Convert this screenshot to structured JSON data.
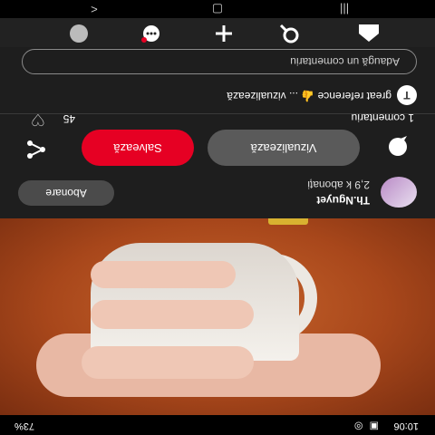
{
  "status_bar": {
    "time": "10:06",
    "battery": "73%",
    "icons": "▣ ◎"
  },
  "photo": {
    "more_label": "•••",
    "next_label": ">"
  },
  "creator": {
    "name": "Th.Nguyet",
    "followers": "2,9 k abonați",
    "follow_label": "Abonare"
  },
  "actions": {
    "view_label": "Vizualizează",
    "save_label": "Salvează"
  },
  "comments": {
    "count_label": "1 comentariu",
    "likes": "45",
    "first": {
      "avatar_letter": "T",
      "text": "great reference 👍 ... vizualizează"
    },
    "input_placeholder": "Adaugă un comentariu"
  },
  "tabs": [
    "home-icon",
    "search-icon",
    "add-icon",
    "notifications-icon",
    "profile-icon"
  ],
  "colors": {
    "save": "#e60023",
    "background": "#1e1e1e"
  }
}
